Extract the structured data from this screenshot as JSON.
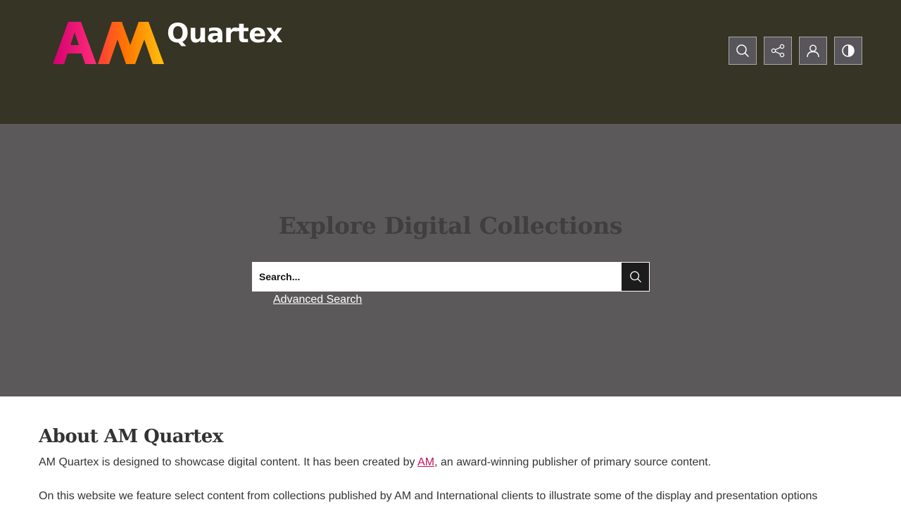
{
  "header": {
    "logo_letters": "AM",
    "logo_text": "Quartex",
    "toolbar": [
      {
        "icon": "search-icon"
      },
      {
        "icon": "share-icon"
      },
      {
        "icon": "user-icon"
      },
      {
        "icon": "contrast-icon"
      }
    ]
  },
  "hero": {
    "title": "Explore Digital Collections",
    "search_placeholder": "Search...",
    "advanced_search_label": "Advanced Search"
  },
  "about": {
    "title": "About AM Quartex",
    "paragraph1_before": "AM Quartex is designed to showcase digital content. It has been created by ",
    "paragraph1_link": "AM",
    "paragraph1_after": ", an award-winning publisher of primary source content.",
    "paragraph2": "On this website we feature select content from collections published by AM and International clients to illustrate some of the display and presentation options"
  },
  "colors": {
    "header_bg": "#353425",
    "hero_bg": "#5b595a",
    "link": "#c6115f",
    "logo_pink": "#e6007e",
    "logo_orange": "#ff6b1a",
    "logo_yellow": "#ffc20e"
  }
}
